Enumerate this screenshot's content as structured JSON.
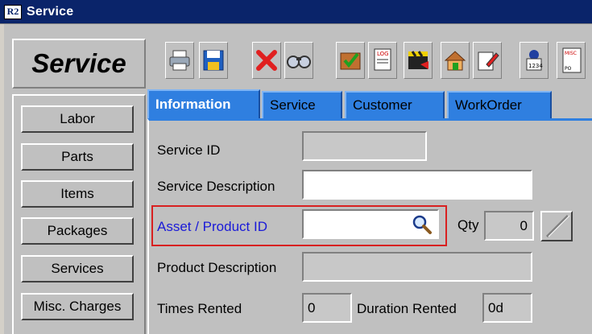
{
  "window": {
    "title": "Service",
    "icon_text": "R2"
  },
  "logo": {
    "text": "Service"
  },
  "toolbar": {
    "buttons": [
      "print-icon",
      "save-icon",
      "delete-icon",
      "find-icon",
      "check-edit-icon",
      "log-icon",
      "clapper-icon",
      "home-icon",
      "note-edit-icon",
      "stamp-icon",
      "misc-po-icon"
    ]
  },
  "sidebar": {
    "items": [
      {
        "label": "Labor"
      },
      {
        "label": "Parts"
      },
      {
        "label": "Items"
      },
      {
        "label": "Packages"
      },
      {
        "label": "Services"
      },
      {
        "label": "Misc. Charges"
      }
    ]
  },
  "tabs": [
    {
      "label": "Information",
      "active": true
    },
    {
      "label": "Service",
      "active": false
    },
    {
      "label": "Customer",
      "active": false
    },
    {
      "label": "WorkOrder",
      "active": false
    }
  ],
  "form": {
    "service_id": {
      "label": "Service ID",
      "value": ""
    },
    "service_description": {
      "label": "Service Description",
      "value": ""
    },
    "asset_product_id": {
      "label": "Asset / Product ID",
      "value": ""
    },
    "qty": {
      "label": "Qty",
      "value": "0"
    },
    "product_description": {
      "label": "Product Description",
      "value": ""
    },
    "times_rented": {
      "label": "Times Rented",
      "value": "0"
    },
    "duration_rented": {
      "label": "Duration Rented",
      "value": "0d"
    }
  },
  "colors": {
    "titlebar": "#0a246a",
    "tab_blue": "#2f7fe0",
    "highlight_red": "#d82020",
    "link_blue": "#1a1ad8"
  }
}
